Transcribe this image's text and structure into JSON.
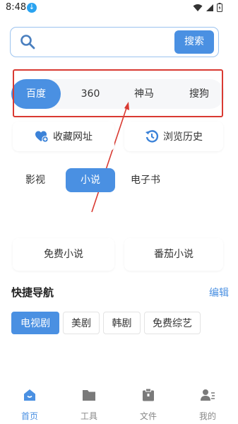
{
  "status": {
    "time": "8:48"
  },
  "search": {
    "placeholder": "",
    "button": "搜索"
  },
  "engines": [
    "百度",
    "360",
    "神马",
    "搜狗"
  ],
  "quick_actions": {
    "favorites": "收藏网址",
    "history": "浏览历史"
  },
  "categories": [
    "影视",
    "小说",
    "电子书"
  ],
  "novel_cards": [
    "免费小说",
    "番茄小说"
  ],
  "quick_nav": {
    "title": "快捷导航",
    "edit": "编辑",
    "chips": [
      "电视剧",
      "美剧",
      "韩剧",
      "免费综艺"
    ]
  },
  "bottom_nav": [
    "首页",
    "工具",
    "文件",
    "我的"
  ],
  "colors": {
    "accent": "#4a90e2",
    "annotation": "#d93a32",
    "inactive": "#888888"
  }
}
